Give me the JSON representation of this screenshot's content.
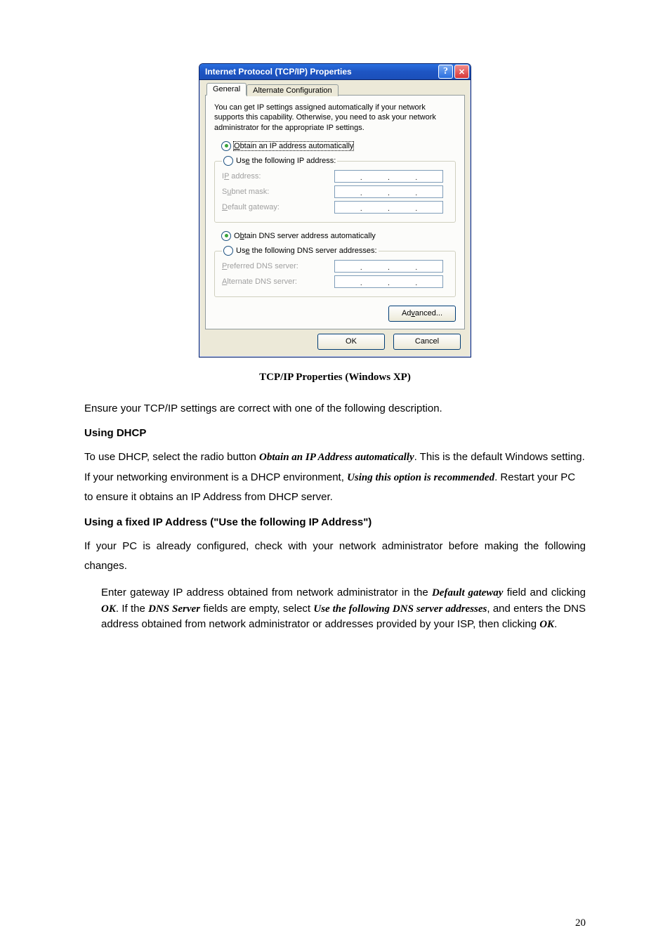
{
  "dialog": {
    "title": "Internet Protocol (TCP/IP) Properties",
    "help_glyph": "?",
    "close_glyph": "✕",
    "tabs": {
      "general": "General",
      "altcfg": "Alternate Configuration"
    },
    "description": "You can get IP settings assigned automatically if your network supports this capability. Otherwise, you need to ask your network administrator for the appropriate IP settings.",
    "ip": {
      "auto_label_pre": "O",
      "auto_label_rest": "btain an IP address automatically",
      "manual_label_pre": "Us",
      "manual_label_u": "e",
      "manual_label_rest": " the following IP address:",
      "fields": {
        "ip_pre": "I",
        "ip_u": "P",
        "ip_rest": " address:",
        "mask_pre": "S",
        "mask_u": "u",
        "mask_rest": "bnet mask:",
        "gw_pre": "",
        "gw_u": "D",
        "gw_rest": "efault gateway:"
      }
    },
    "dns": {
      "auto_pre": "O",
      "auto_u": "b",
      "auto_rest": "tain DNS server address automatically",
      "manual_pre": "Us",
      "manual_u": "e",
      "manual_rest": " the following DNS server addresses:",
      "fields": {
        "pref_pre": "",
        "pref_u": "P",
        "pref_rest": "referred DNS server:",
        "alt_pre": "",
        "alt_u": "A",
        "alt_rest": "lternate DNS server:"
      }
    },
    "advanced_pre": "Ad",
    "advanced_u": "v",
    "advanced_rest": "anced...",
    "ok": "OK",
    "cancel": "Cancel"
  },
  "caption": "TCP/IP Properties (Windows XP)",
  "para_ensure": "Ensure your TCP/IP settings are correct with one of the following description.",
  "heading_dhcp": "Using DHCP",
  "para_dhcp_1a": "To use DHCP, select the radio button ",
  "para_dhcp_1b": "Obtain an IP Address automatically",
  "para_dhcp_1c": ". This is the default Windows setting. If your networking environment is a DHCP environment, ",
  "para_dhcp_1d": "Using this option is recommended",
  "para_dhcp_1e": ". Restart your PC to ensure it obtains an IP Address from DHCP server.",
  "heading_fixed": "Using a fixed IP Address (\"Use the following IP Address\")",
  "para_fixed": "If your PC is already configured, check with your network administrator before making the following changes.",
  "para_indent_1a": "Enter gateway IP address obtained from network administrator in the ",
  "para_indent_1b": "Default gateway",
  "para_indent_1c": " field and clicking ",
  "para_indent_1d": "OK",
  "para_indent_1e": ". If the ",
  "para_indent_1f": "DNS Server",
  "para_indent_1g": " fields are empty, select ",
  "para_indent_1h": "Use the following DNS server addresses",
  "para_indent_1i": ", and enters the DNS address obtained from network administrator or addresses provided by your ISP, then clicking ",
  "para_indent_1j": "OK",
  "para_indent_1k": ".",
  "page_number": "20"
}
